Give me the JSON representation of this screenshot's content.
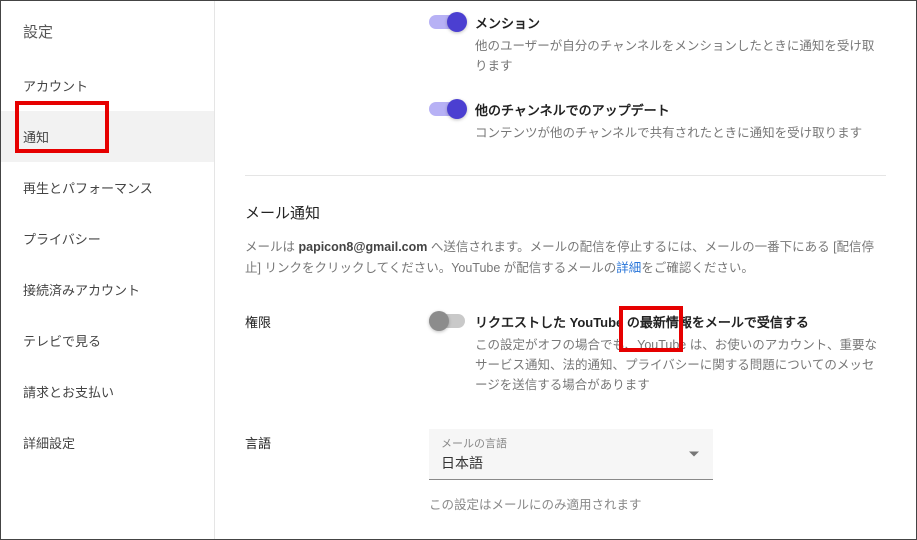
{
  "sidebar": {
    "title": "設定",
    "items": [
      {
        "label": "アカウント"
      },
      {
        "label": "通知",
        "active": true
      },
      {
        "label": "再生とパフォーマンス"
      },
      {
        "label": "プライバシー"
      },
      {
        "label": "接続済みアカウント"
      },
      {
        "label": "テレビで見る"
      },
      {
        "label": "請求とお支払い"
      },
      {
        "label": "詳細設定"
      }
    ]
  },
  "top_toggles": [
    {
      "title": "メンション",
      "desc": "他のユーザーが自分のチャンネルをメンションしたときに通知を受け取ります",
      "on": true
    },
    {
      "title": "他のチャンネルでのアップデート",
      "desc": "コンテンツが他のチャンネルで共有されたときに通知を受け取ります",
      "on": true
    }
  ],
  "email_section": {
    "heading": "メール通知",
    "desc_prefix": "メールは ",
    "email_bold": "papicon8@gmail.com",
    "desc_mid": " へ送信されます。メールの配信を停止するには、メールの一番下にある [配信停止] リンクをクリックしてください。YouTube が配信するメールの",
    "link_text": "詳細",
    "desc_suffix": "をご確認ください。"
  },
  "permission": {
    "label": "権限",
    "toggle_title": "リクエストした YouTube の最新情報をメールで受信する",
    "toggle_desc": "この設定がオフの場合でも、YouTube は、お使いのアカウント、重要なサービス通知、法的通知、プライバシーに関する問題についてのメッセージを送信する場合があります",
    "on": false
  },
  "language": {
    "label": "言語",
    "select_caption": "メールの言語",
    "select_value": "日本語",
    "note": "この設定はメールにのみ適用されます"
  }
}
